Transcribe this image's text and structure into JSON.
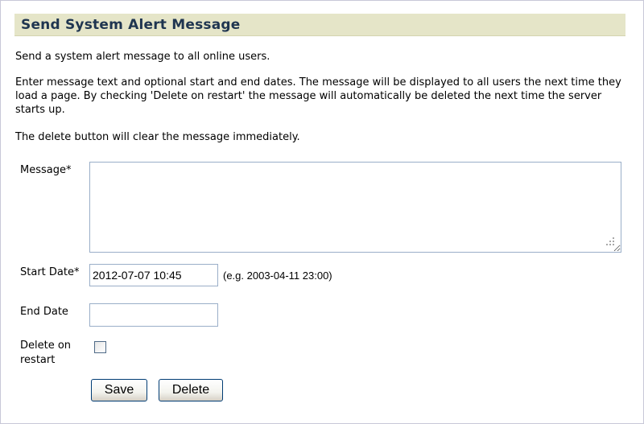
{
  "header": {
    "title": "Send System Alert Message"
  },
  "intro": {
    "line1": "Send a system alert message to all online users.",
    "line2": "Enter message text and optional start and end dates. The message will be displayed to all users the next time they load a page. By checking 'Delete on restart' the message will automatically be deleted the next time the server starts up.",
    "line3": "The delete button will clear the message immediately."
  },
  "form": {
    "message_label": "Message*",
    "message_value": "",
    "start_label": "Start Date*",
    "start_value": "2012-07-07 10:45",
    "start_hint": "(e.g. 2003-04-11 23:00)",
    "end_label": "End Date",
    "end_value": "",
    "delete_on_restart_label": "Delete on restart",
    "delete_on_restart_checked": false,
    "save_label": "Save",
    "delete_label": "Delete"
  },
  "icons": {
    "resize_grip": "resize-grip-icon"
  },
  "colors": {
    "title_bar_bg": "#e5e5c8",
    "title_text": "#1f3550",
    "input_border": "#9aaec8"
  }
}
